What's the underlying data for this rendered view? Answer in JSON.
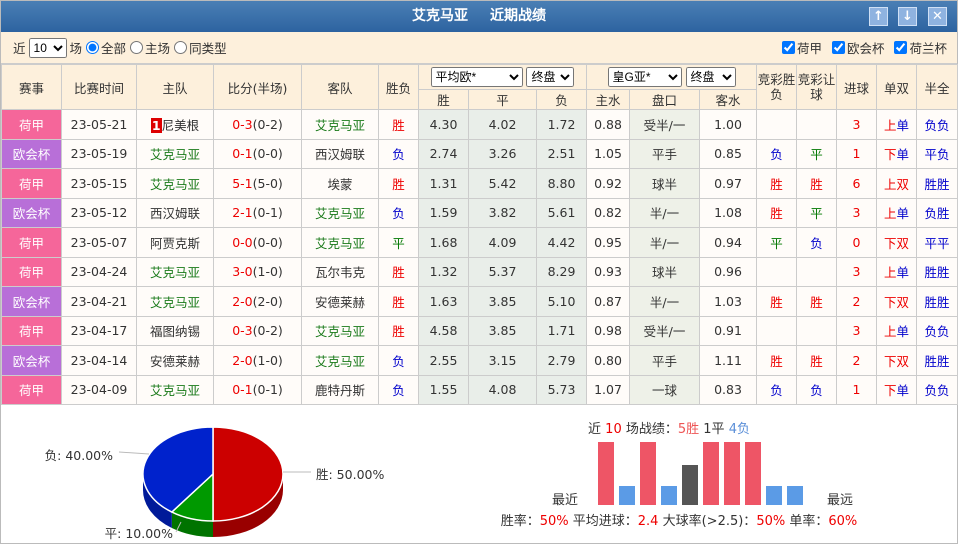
{
  "title": {
    "team": "艾克马亚",
    "label": "近期战绩",
    "buttons": [
      "↑",
      "↓",
      "✕"
    ]
  },
  "filter": {
    "prefix": "近",
    "count": "10",
    "suffix": "场",
    "radios": [
      {
        "label": "全部",
        "checked": true
      },
      {
        "label": "主场",
        "checked": false
      },
      {
        "label": "同类型",
        "checked": false
      }
    ],
    "checks": [
      "荷甲",
      "欧会杯",
      "荷兰杯"
    ]
  },
  "header": {
    "cols": [
      "赛事",
      "比赛时间",
      "主队",
      "比分(半场)",
      "客队",
      "胜负"
    ],
    "euro_select": "平均欧*",
    "euro_type": "终盘",
    "euro_cols": [
      "胜",
      "平",
      "负"
    ],
    "asia_select": "皇G亚*",
    "asia_type": "终盘",
    "asia_cols": [
      "主水",
      "盘口",
      "客水"
    ],
    "jc1": "竞彩胜负",
    "jc2": "竞彩让球",
    "goals": "进球",
    "oe": "单双",
    "htft": "半全"
  },
  "colors": {
    "荷甲": "#f5669a",
    "欧会杯": "#b86fd8"
  },
  "rows": [
    {
      "league": "荷甲",
      "date": "23-05-21",
      "home": "尼美根",
      "home_rank": "1",
      "score": "0-3",
      "half": "(0-2)",
      "away": "艾克马亚",
      "res": "胜",
      "w": "4.30",
      "d": "4.02",
      "l": "1.72",
      "hw": "0.88",
      "hc": "受半/一",
      "aw": "1.00",
      "jc1": "",
      "jc2": "",
      "goals": "3",
      "oe": "上单",
      "htft": "负负",
      "focus": "away"
    },
    {
      "league": "欧会杯",
      "date": "23-05-19",
      "home": "艾克马亚",
      "score": "0-1",
      "half": "(0-0)",
      "away": "西汉姆联",
      "res": "负",
      "w": "2.74",
      "d": "3.26",
      "l": "2.51",
      "hw": "1.05",
      "hc": "平手",
      "aw": "0.85",
      "jc1": "负",
      "jc2": "平",
      "goals": "1",
      "oe": "下单",
      "htft": "平负",
      "focus": "home"
    },
    {
      "league": "荷甲",
      "date": "23-05-15",
      "home": "艾克马亚",
      "score": "5-1",
      "half": "(5-0)",
      "away": "埃蒙",
      "res": "胜",
      "w": "1.31",
      "d": "5.42",
      "l": "8.80",
      "hw": "0.92",
      "hc": "球半",
      "aw": "0.97",
      "jc1": "胜",
      "jc2": "胜",
      "goals": "6",
      "oe": "上双",
      "htft": "胜胜",
      "focus": "home"
    },
    {
      "league": "欧会杯",
      "date": "23-05-12",
      "home": "西汉姆联",
      "score": "2-1",
      "half": "(0-1)",
      "away": "艾克马亚",
      "res": "负",
      "w": "1.59",
      "d": "3.82",
      "l": "5.61",
      "hw": "0.82",
      "hc": "半/一",
      "aw": "1.08",
      "jc1": "胜",
      "jc2": "平",
      "goals": "3",
      "oe": "上单",
      "htft": "负胜",
      "focus": "away"
    },
    {
      "league": "荷甲",
      "date": "23-05-07",
      "home": "阿贾克斯",
      "score": "0-0",
      "half": "(0-0)",
      "away": "艾克马亚",
      "res": "平",
      "w": "1.68",
      "d": "4.09",
      "l": "4.42",
      "hw": "0.95",
      "hc": "半/一",
      "aw": "0.94",
      "jc1": "平",
      "jc2": "负",
      "goals": "0",
      "oe": "下双",
      "htft": "平平",
      "focus": "away"
    },
    {
      "league": "荷甲",
      "date": "23-04-24",
      "home": "艾克马亚",
      "score": "3-0",
      "half": "(1-0)",
      "away": "瓦尔韦克",
      "res": "胜",
      "w": "1.32",
      "d": "5.37",
      "l": "8.29",
      "hw": "0.93",
      "hc": "球半",
      "aw": "0.96",
      "jc1": "",
      "jc2": "",
      "goals": "3",
      "oe": "上单",
      "htft": "胜胜",
      "focus": "home"
    },
    {
      "league": "欧会杯",
      "date": "23-04-21",
      "home": "艾克马亚",
      "score": "2-0",
      "half": "(2-0)",
      "away": "安德莱赫",
      "res": "胜",
      "w": "1.63",
      "d": "3.85",
      "l": "5.10",
      "hw": "0.87",
      "hc": "半/一",
      "aw": "1.03",
      "jc1": "胜",
      "jc2": "胜",
      "goals": "2",
      "oe": "下双",
      "htft": "胜胜",
      "focus": "home"
    },
    {
      "league": "荷甲",
      "date": "23-04-17",
      "home": "福图纳锡",
      "score": "0-3",
      "half": "(0-2)",
      "away": "艾克马亚",
      "res": "胜",
      "w": "4.58",
      "d": "3.85",
      "l": "1.71",
      "hw": "0.98",
      "hc": "受半/一",
      "aw": "0.91",
      "jc1": "",
      "jc2": "",
      "goals": "3",
      "oe": "上单",
      "htft": "负负",
      "focus": "away"
    },
    {
      "league": "欧会杯",
      "date": "23-04-14",
      "home": "安德莱赫",
      "score": "2-0",
      "half": "(1-0)",
      "away": "艾克马亚",
      "res": "负",
      "w": "2.55",
      "d": "3.15",
      "l": "2.79",
      "hw": "0.80",
      "hc": "平手",
      "aw": "1.11",
      "jc1": "胜",
      "jc2": "胜",
      "goals": "2",
      "oe": "下双",
      "htft": "胜胜",
      "focus": "away"
    },
    {
      "league": "荷甲",
      "date": "23-04-09",
      "home": "艾克马亚",
      "score": "0-1",
      "half": "(0-1)",
      "away": "鹿特丹斯",
      "res": "负",
      "w": "1.55",
      "d": "4.08",
      "l": "5.73",
      "hw": "1.07",
      "hc": "一球",
      "aw": "0.83",
      "jc1": "负",
      "jc2": "负",
      "goals": "1",
      "oe": "下单",
      "htft": "负负",
      "focus": "home"
    }
  ],
  "chart_data": {
    "type": "pie",
    "slices": [
      {
        "name": "胜",
        "label": "胜: 50.00%",
        "value": 50,
        "color": "#cc0000"
      },
      {
        "name": "平",
        "label": "平: 10.00%",
        "value": 10,
        "color": "#009900"
      },
      {
        "name": "负",
        "label": "负: 40.00%",
        "value": 40,
        "color": "#0022cc"
      }
    ],
    "bars": {
      "type": "bar",
      "results": [
        "胜",
        "负",
        "胜",
        "负",
        "平",
        "胜",
        "胜",
        "胜",
        "负",
        "负"
      ],
      "left_label": "最近",
      "right_label": "最远"
    }
  },
  "summary": {
    "p1": "近 ",
    "n": "10",
    "p2": " 场战绩：",
    "w": "5胜",
    "d": " 1平 ",
    "l": "4负"
  },
  "stats": {
    "win_label": "胜率：",
    "win": "50%",
    "avg_label": " 平均进球：",
    "avg": "2.4",
    "big_label": " 大球率(>2.5)：",
    "big": "50%",
    "odd_label": " 单率：",
    "odd": "60%"
  }
}
